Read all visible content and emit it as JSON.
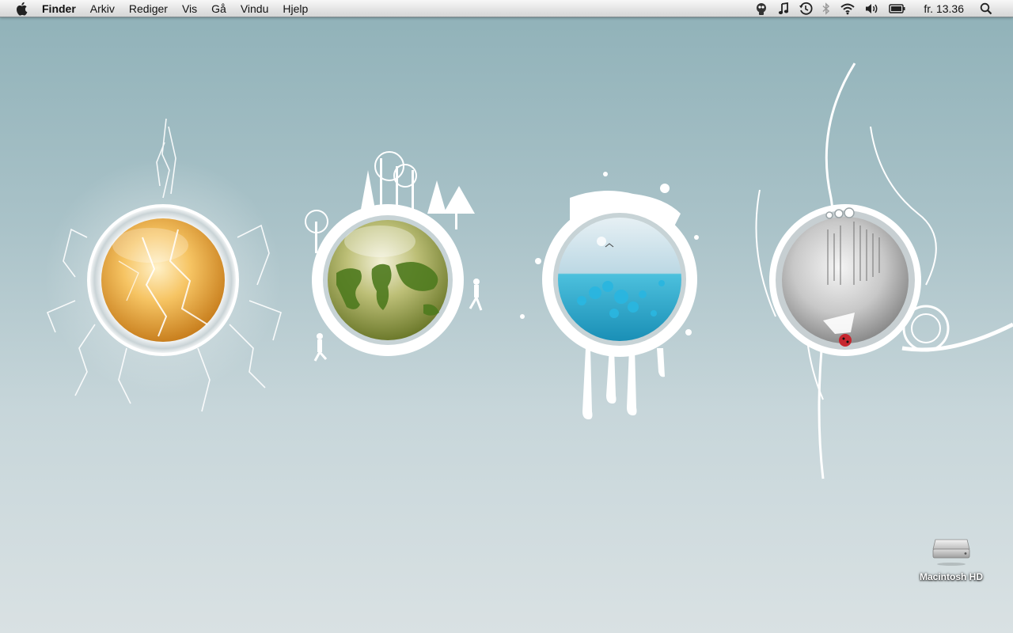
{
  "menubar": {
    "apple_icon": "apple-icon",
    "app_name": "Finder",
    "menus": [
      "Arkiv",
      "Rediger",
      "Vis",
      "Gå",
      "Vindu",
      "Hjelp"
    ],
    "status_icons": [
      "user-robot-icon",
      "music-note-icon",
      "time-machine-icon",
      "bluetooth-icon",
      "wifi-icon",
      "volume-icon",
      "battery-icon"
    ],
    "clock": "fr. 13.36",
    "spotlight_icon": "spotlight-search-icon"
  },
  "wallpaper": {
    "orbs": [
      "lightning-orb",
      "earth-orb",
      "water-orb",
      "paper-orb"
    ],
    "colors": {
      "sky_top": "#8fb1b8",
      "sky_bottom": "#d9e1e3",
      "lightning": "#f3b54a",
      "earth": "#9aa84a",
      "water": "#2aa6c8",
      "paper": "#bdbdbd"
    }
  },
  "desktop": {
    "drive_label": "Macintosh HD",
    "drive_icon": "hard-drive-icon"
  }
}
